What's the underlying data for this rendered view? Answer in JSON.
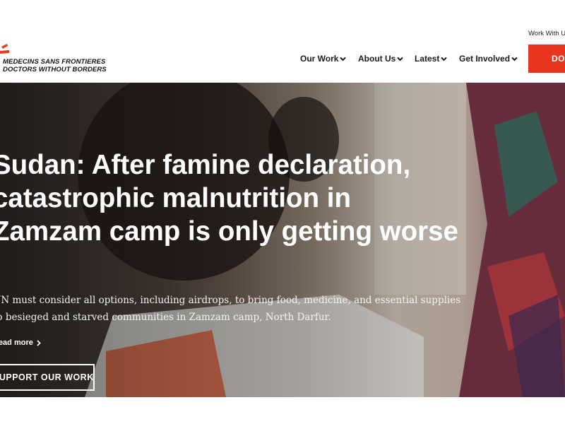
{
  "brand": {
    "line1": "MEDECINS SANS FRONTIERES",
    "line2": "DOCTORS WITHOUT BORDERS",
    "accent": "#e8361e"
  },
  "header": {
    "utility_link": "Work With Us",
    "donate_label": "DONATE"
  },
  "nav": {
    "items": [
      {
        "label": "Our Work"
      },
      {
        "label": "About Us"
      },
      {
        "label": "Latest"
      },
      {
        "label": "Get Involved"
      }
    ],
    "chevron_icon": "chevron-down-icon"
  },
  "hero": {
    "headline": "Sudan: After famine declaration, catastrophic malnutrition in Zamzam camp is only getting worse",
    "subtext": "UN must consider all options, including airdrops, to bring food, medicine, and essential supplies to besieged and starved communities in Zamzam camp, North Darfur.",
    "more_label": "Read more",
    "more_icon": "chevron-right-icon",
    "cta_label": "SUPPORT OUR WORK"
  }
}
